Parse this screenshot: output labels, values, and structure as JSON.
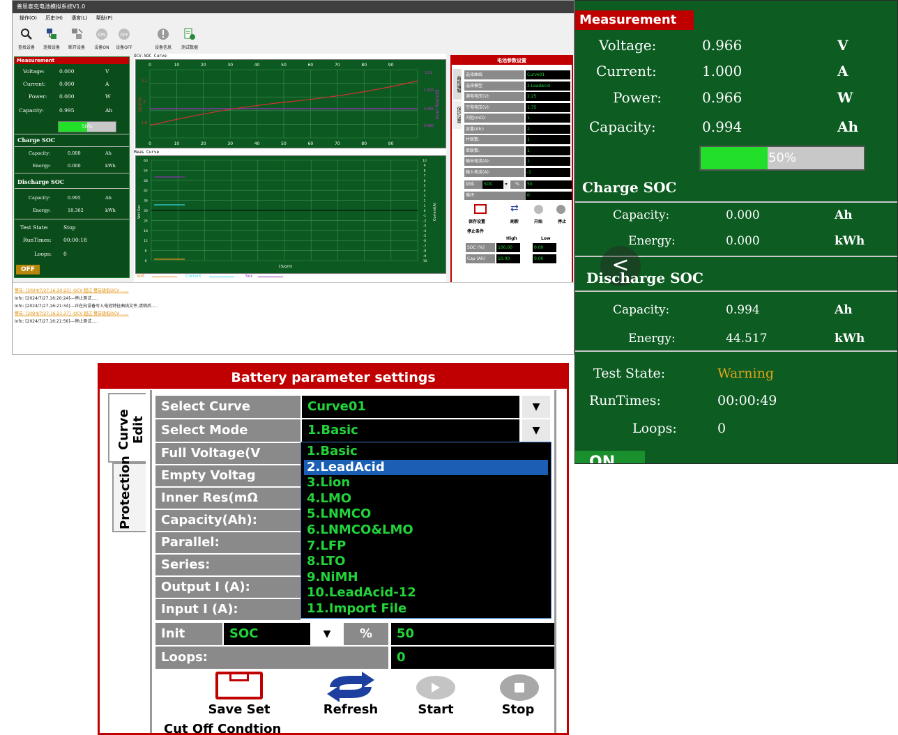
{
  "main_window": {
    "title": "善思泰克电池模拟系统V1.0",
    "menu": [
      "操作(O)",
      "历史(H)",
      "语言(L)",
      "帮助(P)"
    ],
    "toolbar": [
      {
        "label": "查找设备",
        "icon": "search-icon"
      },
      {
        "label": "连接设备",
        "icon": "connect-icon"
      },
      {
        "label": "断开设备",
        "icon": "disconnect-icon"
      },
      {
        "label": "设备ON",
        "icon": "power-on-icon"
      },
      {
        "label": "设备OFF",
        "icon": "power-off-icon"
      },
      {
        "label": "设备信息",
        "icon": "info-icon"
      },
      {
        "label": "测试数据",
        "icon": "data-icon"
      }
    ],
    "measurement": {
      "title": "Measurement",
      "rows": [
        {
          "label": "Voltage:",
          "value": "0.000",
          "unit": "V"
        },
        {
          "label": "Current:",
          "value": "0.000",
          "unit": "A"
        },
        {
          "label": "Power:",
          "value": "0.000",
          "unit": "W"
        },
        {
          "label": "Capacity:",
          "value": "0.995",
          "unit": "Ah"
        }
      ],
      "progress_text": "50%",
      "progress": 0.5,
      "charge_title": "Charge SOC",
      "charge": [
        {
          "label": "Capacity:",
          "value": "0.000",
          "unit": "Ah"
        },
        {
          "label": "Energy:",
          "value": "0.000",
          "unit": "kWh"
        }
      ],
      "discharge_title": "Discharge SOC",
      "discharge": [
        {
          "label": "Capacity:",
          "value": "0.995",
          "unit": "Ah"
        },
        {
          "label": "Energy:",
          "value": "18.362",
          "unit": "kWh"
        }
      ],
      "test_state_label": "Test State:",
      "test_state": "Stop",
      "runtimes_label": "RunTimes:",
      "runtimes": "00:00:18",
      "loops_label": "Loops:",
      "loops": "0",
      "off_button": "OFF"
    },
    "ocv_chart": {
      "title": "OCV-SOC Curve",
      "x_ticks": [
        "0",
        "10",
        "20",
        "30",
        "40",
        "50",
        "60",
        "70",
        "80",
        "90"
      ],
      "y_left_ticks": [
        "2.2",
        "2",
        "1.8"
      ],
      "y_right_ticks": [
        "1.01",
        "1.000",
        "0.995",
        "0.990"
      ],
      "ylabel_left": "OCV(V)",
      "ylabel_right": "Inner Res(mΩ)"
    },
    "meas_chart": {
      "title": "Meas Curve",
      "y_left_ticks": [
        "60",
        "54",
        "48",
        "42",
        "36",
        "30",
        "24",
        "18",
        "12",
        "6",
        "0"
      ],
      "y_right_ticks": [
        "10",
        "9",
        "8",
        "7",
        "6",
        "5",
        "4",
        "3",
        "2",
        "1",
        "0",
        "-1",
        "-2",
        "-3",
        "-4",
        "-5",
        "-6",
        "-7",
        "-8",
        "-9",
        "-10"
      ],
      "ylabel_left": "Volt Soc",
      "ylabel_right": "Current(A)",
      "xlabel": "1S/grid",
      "legend": [
        {
          "name": "Volt",
          "color": "#e08a1e"
        },
        {
          "name": "Current",
          "color": "#2fd4e6"
        },
        {
          "name": "Soc",
          "color": "#8b2fb0"
        }
      ]
    },
    "settings_small": {
      "title": "电池参数设置",
      "tabs": [
        "曲线编辑",
        "保护设置"
      ],
      "rows": [
        {
          "label": "选择曲线",
          "value": "Curve01"
        },
        {
          "label": "选择模型",
          "value": "2.LeadAcid"
        },
        {
          "label": "满电电压(V):",
          "value": "2.25"
        },
        {
          "label": "空电电压(V):",
          "value": "1.75"
        },
        {
          "label": "内阻(mΩ):",
          "value": "1"
        },
        {
          "label": "容量(Ah):",
          "value": "2"
        },
        {
          "label": "并联数:",
          "value": "1"
        },
        {
          "label": "串联数:",
          "value": "1"
        },
        {
          "label": "输出电流(A):",
          "value": "1"
        },
        {
          "label": "输入电流(A):",
          "value": "-1"
        }
      ],
      "init_label": "初始",
      "init_mode": "SOC",
      "init_unit": "%",
      "init_value": "50",
      "loops_label": "循环:",
      "loops_value": "0",
      "buttons": [
        "保存设置",
        "刷新",
        "开始",
        "停止"
      ],
      "cutoff_label": "停止条件",
      "high_label": "High",
      "low_label": "Low",
      "cut_rows": [
        {
          "label": "SOC (%)",
          "high": "100.00",
          "low": "0.00"
        },
        {
          "label": "Cap (Ah)",
          "high": "10.00",
          "low": "0.00"
        }
      ]
    },
    "log": [
      {
        "text": "警告: [2024/7/27,16:20:23] -OCV  超过 警告极低OCV ......",
        "type": "warn"
      },
      {
        "text": "Info: [2024/7/27,16:20:24]---停止测试.....",
        "type": "info"
      },
      {
        "text": "Info: [2024/7/27,16:21:34]---正在向设备写入电池特征曲线文件,请稍后.....",
        "type": "info"
      },
      {
        "text": "警告: [2024/7/27,16:21:37] -OCV  超过 警告极低OCV ......",
        "type": "warn"
      },
      {
        "text": "Info: [2024/7/27,16:21:56]---停止测试.....",
        "type": "info"
      }
    ]
  },
  "big_measurement": {
    "title": "Measurement",
    "rows": [
      {
        "label": "Voltage:",
        "value": "0.966",
        "unit": "V"
      },
      {
        "label": "Current:",
        "value": "1.000",
        "unit": "A"
      },
      {
        "label": "Power:",
        "value": "0.966",
        "unit": "W"
      },
      {
        "label": "Capacity:",
        "value": "0.994",
        "unit": "Ah"
      }
    ],
    "progress_text": "50%",
    "progress": 0.5,
    "charge_title": "Charge SOC",
    "charge": [
      {
        "label": "Capacity:",
        "value": "0.000",
        "unit": "Ah"
      },
      {
        "label": "Energy:",
        "value": "0.000",
        "unit": "kWh"
      }
    ],
    "discharge_title": "Discharge SOC",
    "discharge": [
      {
        "label": "Capacity:",
        "value": "0.994",
        "unit": "Ah"
      },
      {
        "label": "Energy:",
        "value": "44.517",
        "unit": "kWh"
      }
    ],
    "test_state_label": "Test State:",
    "test_state": "Warning",
    "runtimes_label": "RunTimes:",
    "runtimes": "00:00:49",
    "loops_label": "Loops:",
    "loops": "0",
    "on_button": "ON",
    "back_glyph": "<"
  },
  "battery_settings": {
    "title": "Battery parameter settings",
    "tabs": [
      "Curve Edit",
      "Protection"
    ],
    "select_curve_label": "Select Curve",
    "select_curve_value": "Curve01",
    "select_mode_label": "Select Mode",
    "select_mode_value": "1.Basic",
    "labels": [
      "Full Voltage(V",
      "Empty Voltag",
      "Inner Res(mΩ",
      "Capacity(Ah):",
      "Parallel:",
      "Series:",
      "Output I (A):",
      "Input I (A):"
    ],
    "mode_options": [
      "1.Basic",
      "2.LeadAcid",
      "3.Lion",
      "4.LMO",
      "5.LNMCO",
      "6.LNMCO&LMO",
      "7.LFP",
      "8.LTO",
      "9.NiMH",
      "10.LeadAcid-12",
      "11.Import File"
    ],
    "highlighted_option": "2.LeadAcid",
    "init_label": "Init",
    "init_mode": "SOC",
    "init_unit": "%",
    "init_value": "50",
    "loops_label": "Loops:",
    "loops_value": "0",
    "buttons": [
      "Save Set",
      "Refresh",
      "Start",
      "Stop"
    ],
    "cutoff_label": "Cut Off Condtion"
  }
}
